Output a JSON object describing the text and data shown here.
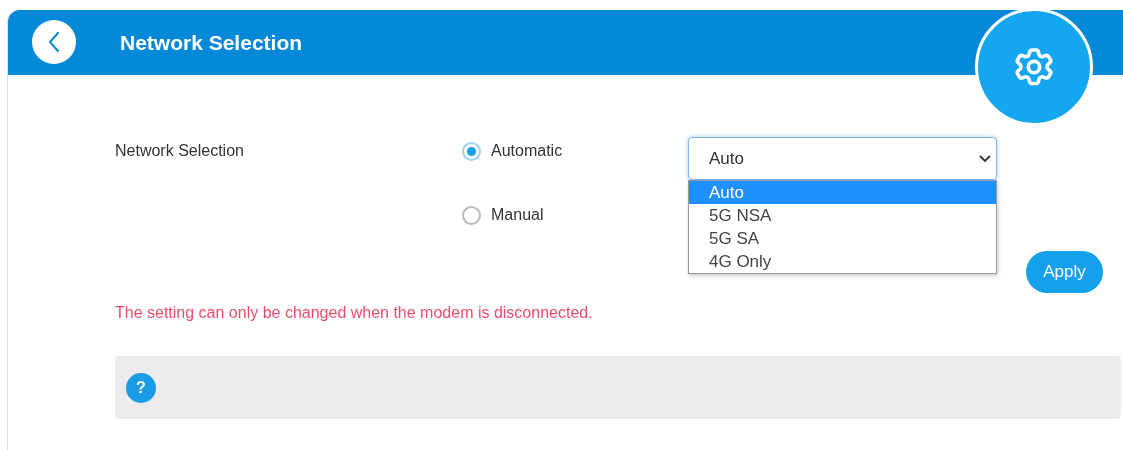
{
  "header": {
    "title": "Network Selection"
  },
  "form": {
    "label": "Network Selection",
    "modes": [
      {
        "label": "Automatic",
        "selected": true
      },
      {
        "label": "Manual",
        "selected": false
      }
    ],
    "select": {
      "value": "Auto",
      "expanded": true,
      "options": [
        {
          "label": "Auto",
          "selected": true
        },
        {
          "label": "5G NSA",
          "selected": false
        },
        {
          "label": "5G SA",
          "selected": false
        },
        {
          "label": "4G Only",
          "selected": false
        }
      ]
    },
    "apply_button": "Apply",
    "warning": "The setting can only be changed when the modem is disconnected."
  },
  "help": {
    "icon": "?"
  }
}
